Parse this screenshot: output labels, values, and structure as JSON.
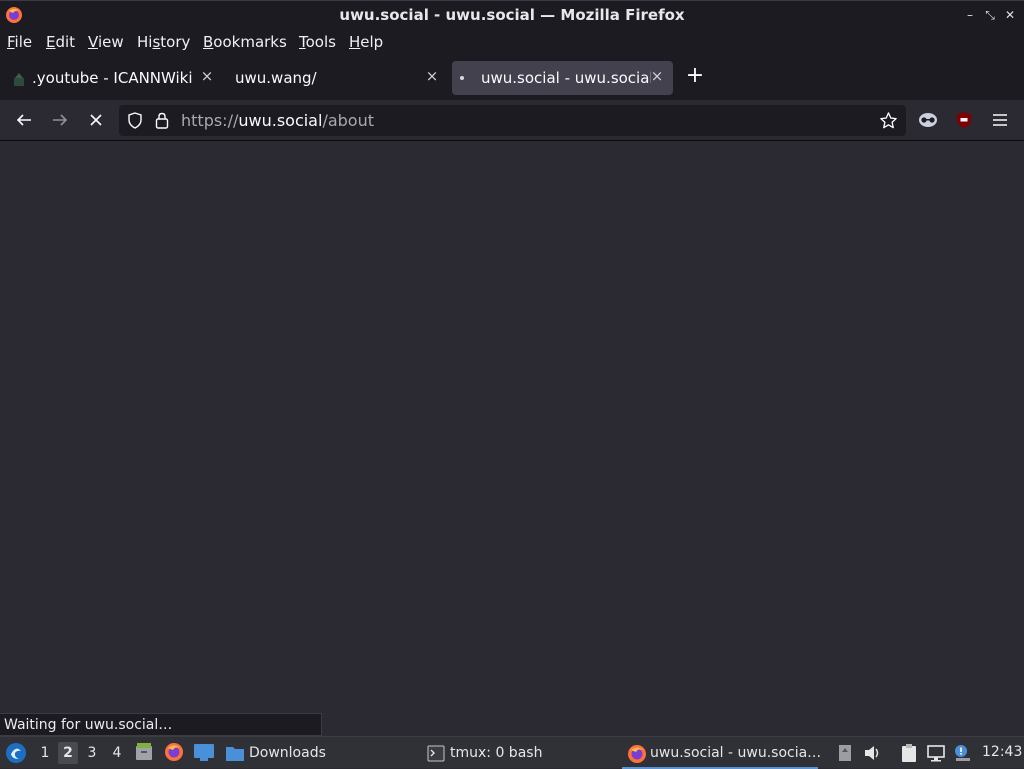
{
  "window": {
    "title": "uwu.social - uwu.social — Mozilla Firefox"
  },
  "menu": {
    "items": [
      {
        "label": "File",
        "accel": "F",
        "rest": "ile"
      },
      {
        "label": "Edit",
        "accel": "E",
        "rest": "dit"
      },
      {
        "label": "View",
        "accel": "V",
        "rest": "iew"
      },
      {
        "label": "History",
        "accel": "s",
        "pre": "Hi",
        "rest": "tory"
      },
      {
        "label": "Bookmarks",
        "accel": "B",
        "rest": "ookmarks"
      },
      {
        "label": "Tools",
        "accel": "T",
        "rest": "ools"
      },
      {
        "label": "Help",
        "accel": "H",
        "rest": "elp"
      }
    ]
  },
  "tabs": [
    {
      "label": ".youtube - ICANNWiki",
      "active": false
    },
    {
      "label": "uwu.wang/",
      "active": false
    },
    {
      "label": "uwu.social - uwu.social",
      "active": true,
      "loading": true
    }
  ],
  "urlbar": {
    "scheme": "https://",
    "host": "uwu.social",
    "path": "/about"
  },
  "status": {
    "text": "Waiting for uwu.social…"
  },
  "taskbar": {
    "workspaces": [
      "1",
      "2",
      "3",
      "4"
    ],
    "current_workspace": "2",
    "tasks": [
      {
        "label": "Downloads",
        "icon": "folder-icon"
      },
      {
        "label": "tmux: 0 bash",
        "icon": "terminal-icon"
      },
      {
        "label": "uwu.social - uwu.socia…",
        "icon": "firefox-icon",
        "active": true
      }
    ],
    "clock": "12:43"
  },
  "colors": {
    "chrome_dark": "#1c1b22",
    "content_bg": "#2b2a33",
    "tab_active": "#42414d",
    "taskbar_accent": "#5a94d6"
  }
}
